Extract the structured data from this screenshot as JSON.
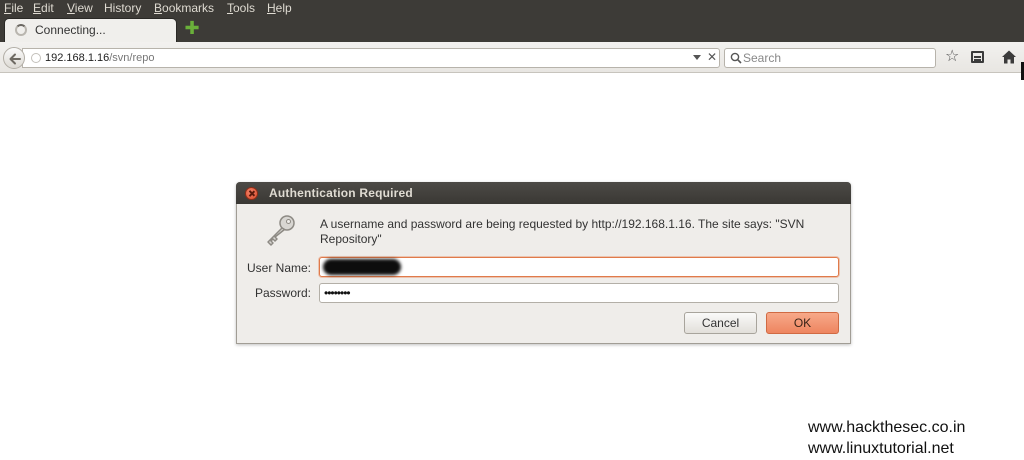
{
  "menubar": {
    "items": [
      {
        "label": "File",
        "underline": "F",
        "rest": "ile"
      },
      {
        "label": "Edit",
        "underline": "E",
        "rest": "dit"
      },
      {
        "label": "View",
        "underline": "V",
        "rest": "iew"
      },
      {
        "label": "History",
        "underline": "H",
        "rest": "istory",
        "prefix": ""
      },
      {
        "label": "Bookmarks",
        "underline": "B",
        "rest": "ookmarks"
      },
      {
        "label": "Tools",
        "underline": "T",
        "rest": "ools"
      },
      {
        "label": "Help",
        "underline": "H",
        "rest": "elp"
      }
    ]
  },
  "tab": {
    "title": "Connecting..."
  },
  "navbar": {
    "url_host": "192.168.1.16",
    "url_path": "/svn/repo",
    "search_placeholder": "Search"
  },
  "dialog": {
    "title": "Authentication Required",
    "message": "A username and password are being requested by http://192.168.1.16. The site says: \"SVN Repository\"",
    "username_label": "User Name:",
    "password_label": "Password:",
    "password_masked": "••••••••",
    "cancel_label": "Cancel",
    "ok_label": "OK"
  },
  "watermark": {
    "line1": "www.hackthesec.co.in",
    "line2": "www.linuxtutorial.net"
  },
  "colors": {
    "titlebar": "#3d3b37",
    "accent_ok": "#ee8560",
    "focus_ring": "#e07a4a"
  },
  "icons": {
    "tab_spinner": "loading-spinner-icon",
    "new_tab": "plus-icon",
    "back": "back-arrow-icon",
    "search": "search-icon",
    "bookmark": "star-icon",
    "bookmarks_menu": "bookmarks-list-icon",
    "home": "home-icon",
    "dialog_close": "close-icon",
    "dialog_key": "key-icon"
  }
}
